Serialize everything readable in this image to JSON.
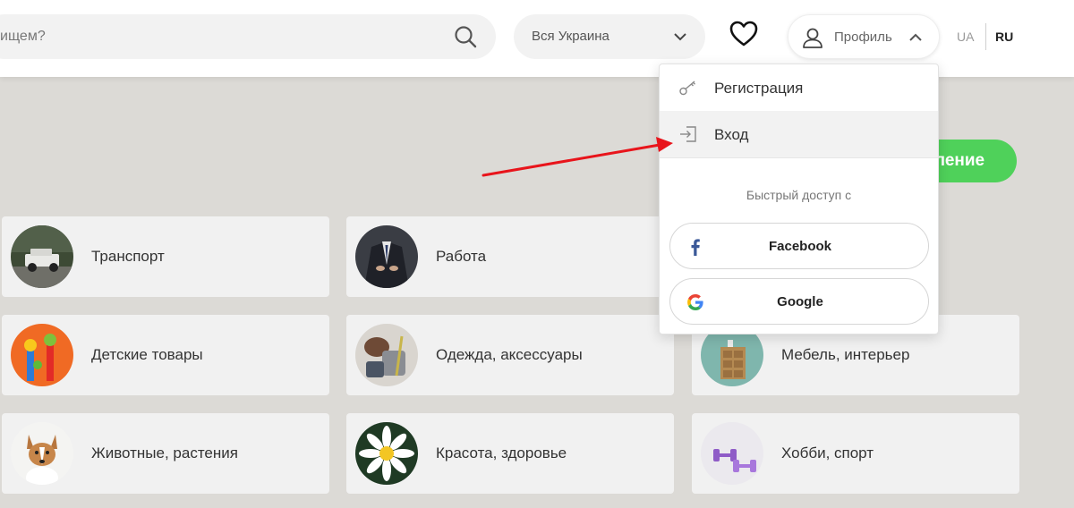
{
  "header": {
    "search_placeholder": "ищем?",
    "region": "Вся Украина",
    "profile_label": "Профиль",
    "lang_ua": "UA",
    "lang_ru": "RU"
  },
  "add_button_label": "ление",
  "categories": [
    {
      "label": "Транспорт",
      "icon": "car-photo"
    },
    {
      "label": "Работа",
      "icon": "business-suit-photo"
    },
    {
      "label": "Детские товары",
      "icon": "toys-photo"
    },
    {
      "label": "Одежда, аксессуары",
      "icon": "clothes-photo"
    },
    {
      "label": "Мебель, интерьер",
      "icon": "cabinet-photo"
    },
    {
      "label": "Животные, растения",
      "icon": "dog-photo"
    },
    {
      "label": "Красота, здоровье",
      "icon": "flower-photo"
    },
    {
      "label": "Хобби, спорт",
      "icon": "dumbbells-photo"
    }
  ],
  "dropdown": {
    "items": [
      {
        "label": "Регистрация",
        "icon": "key-icon"
      },
      {
        "label": "Вход",
        "icon": "login-icon"
      }
    ],
    "quick_access_title": "Быстрый доступ с",
    "social": [
      {
        "label": "Facebook",
        "icon": "facebook-icon"
      },
      {
        "label": "Google",
        "icon": "google-icon"
      }
    ]
  },
  "colors": {
    "accent_green": "#4fd15a",
    "annotation_red": "#e8141b",
    "facebook_blue": "#3b5998"
  }
}
